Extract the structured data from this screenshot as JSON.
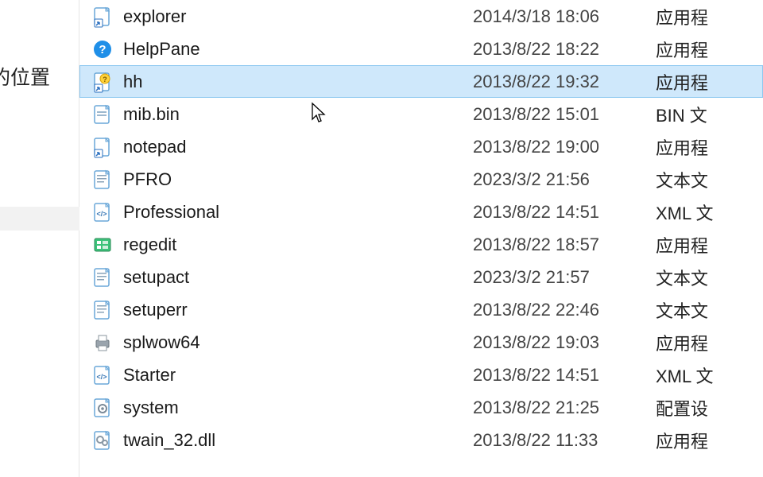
{
  "sidebar": {
    "label": "的位置"
  },
  "files": [
    {
      "name": "explorer",
      "date": "2014/3/18 18:06",
      "type": "应用程",
      "icon": "shortcut"
    },
    {
      "name": "HelpPane",
      "date": "2013/8/22 18:22",
      "type": "应用程",
      "icon": "help-app"
    },
    {
      "name": "hh",
      "date": "2013/8/22 19:32",
      "type": "应用程",
      "icon": "chm",
      "selected": true
    },
    {
      "name": "mib.bin",
      "date": "2013/8/22 15:01",
      "type": "BIN 文",
      "icon": "file"
    },
    {
      "name": "notepad",
      "date": "2013/8/22 19:00",
      "type": "应用程",
      "icon": "shortcut"
    },
    {
      "name": "PFRO",
      "date": "2023/3/2 21:56",
      "type": "文本文",
      "icon": "txt"
    },
    {
      "name": "Professional",
      "date": "2013/8/22 14:51",
      "type": "XML 文",
      "icon": "xml"
    },
    {
      "name": "regedit",
      "date": "2013/8/22 18:57",
      "type": "应用程",
      "icon": "regedit"
    },
    {
      "name": "setupact",
      "date": "2023/3/2 21:57",
      "type": "文本文",
      "icon": "txt"
    },
    {
      "name": "setuperr",
      "date": "2013/8/22 22:46",
      "type": "文本文",
      "icon": "txt"
    },
    {
      "name": "splwow64",
      "date": "2013/8/22 19:03",
      "type": "应用程",
      "icon": "printer"
    },
    {
      "name": "Starter",
      "date": "2013/8/22 14:51",
      "type": "XML 文",
      "icon": "xml"
    },
    {
      "name": "system",
      "date": "2013/8/22 21:25",
      "type": "配置设",
      "icon": "ini"
    },
    {
      "name": "twain_32.dll",
      "date": "2013/8/22 11:33",
      "type": "应用程",
      "icon": "dll"
    }
  ]
}
